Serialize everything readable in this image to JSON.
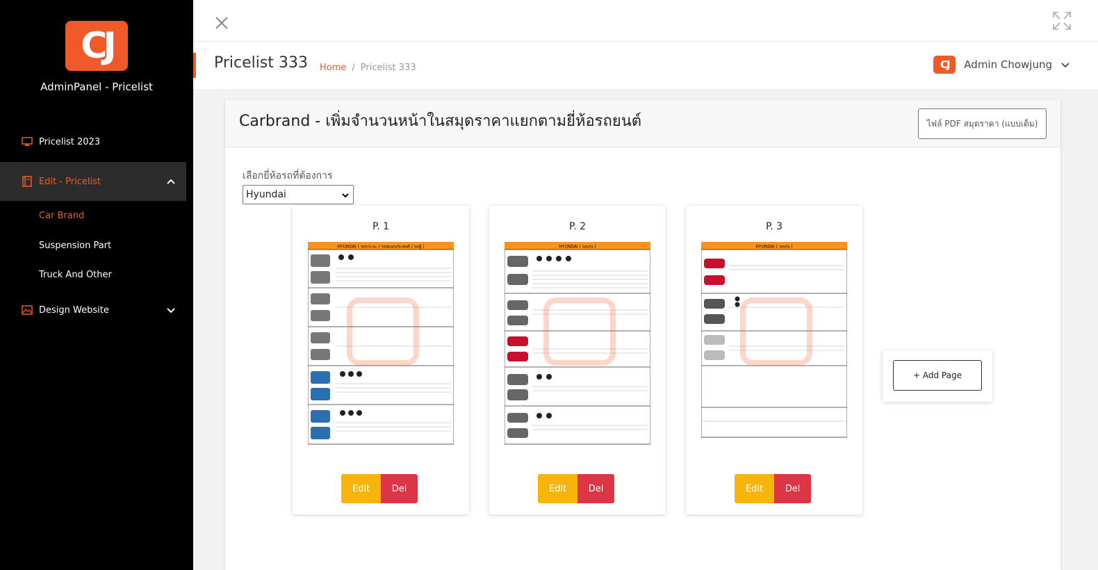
{
  "sidebar": {
    "logo_text": "CJ",
    "title": "AdminPanel - Pricelist",
    "items": [
      {
        "label": "Pricelist 2023"
      },
      {
        "label": "Edit - Pricelist"
      },
      {
        "label": "Design Website"
      }
    ],
    "subitems": [
      {
        "label": "Car Brand"
      },
      {
        "label": "Suspension Part"
      },
      {
        "label": "Truck And Other"
      }
    ]
  },
  "header": {
    "page_title": "Pricelist 333",
    "breadcrumb_home": "Home",
    "breadcrumb_sep": "/",
    "breadcrumb_current": "Pricelist 333",
    "user_logo": "CJ",
    "user_name": "Admin Chowjung"
  },
  "card": {
    "title": "Carbrand - เพิ่มจำนวนหน้าในสมุดราคาแยกตามยี่ห้อรถยนต์",
    "pdf_button": "ไฟล์ PDF สมุดราคา (แบบเต็ม)",
    "select_label": "เลือกยี่ห้อรถที่ต้องการ",
    "selected_brand": "Hyundai"
  },
  "pages": [
    {
      "label": "P. 1",
      "header": "HYUNDAI ( รถกระบะ / รถอเนกประสงค์ / รถตู้ )"
    },
    {
      "label": "P. 2",
      "header": "HYUNDAI ( รถเก๋ง )"
    },
    {
      "label": "P. 3",
      "header": "HYUNDAI ( รถเก๋ง )"
    }
  ],
  "actions": {
    "edit": "Edit",
    "del": "Del",
    "add_page": "+ Add Page"
  },
  "colors": {
    "accent": "#f05a28",
    "edit": "#f7b50c",
    "delete": "#dc3545"
  }
}
